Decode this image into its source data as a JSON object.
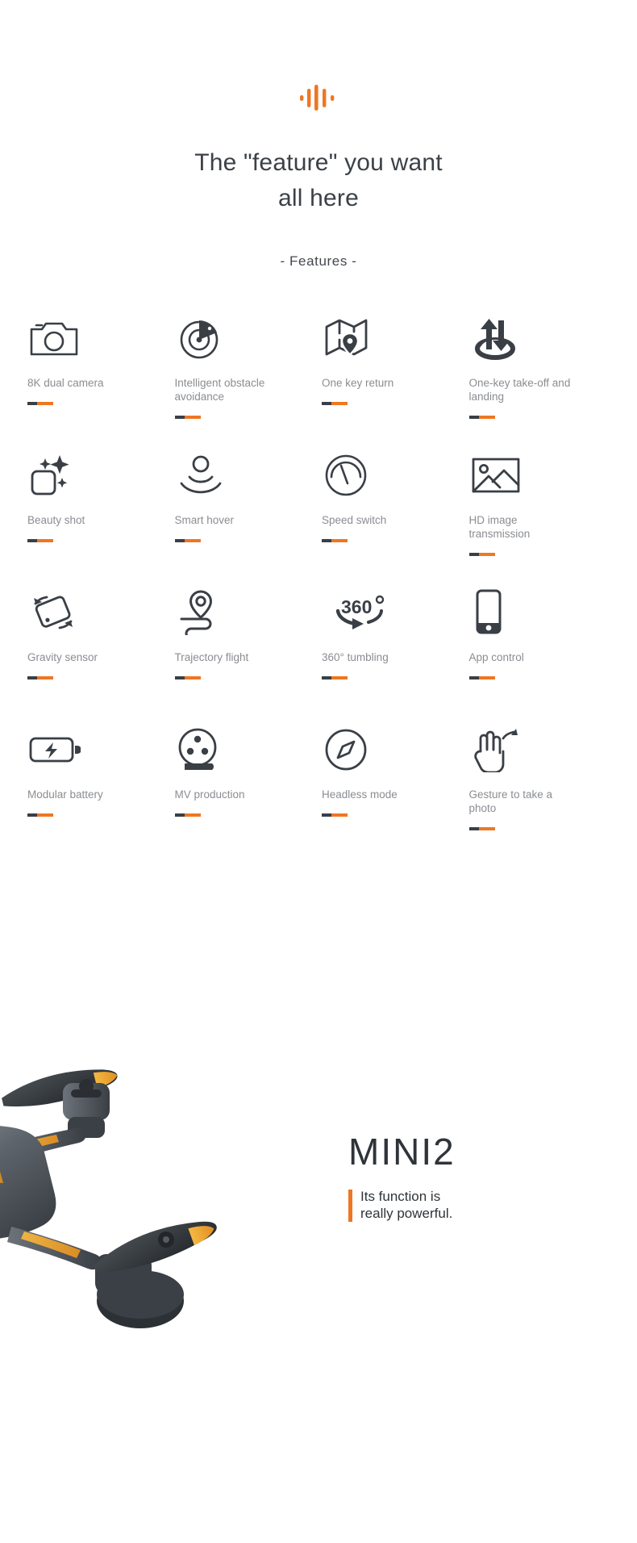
{
  "header": {
    "wave_icon": "audio-wave-icon",
    "wave_color": "#ee7722",
    "headline_line1": "The \"feature\" you want",
    "headline_line2": "all here",
    "section_label": "- Features -"
  },
  "accent": {
    "dark_color": "#3a3f46",
    "orange_color": "#ee7722"
  },
  "features": [
    {
      "icon": "camera-icon",
      "label": "8K dual camera"
    },
    {
      "icon": "radar-obstacle-icon",
      "label": "Intelligent obstacle avoidance"
    },
    {
      "icon": "map-pin-icon",
      "label": "One key return"
    },
    {
      "icon": "takeoff-landing-icon",
      "label": "One-key take-off and landing"
    },
    {
      "icon": "beauty-sparkle-icon",
      "label": "Beauty shot"
    },
    {
      "icon": "hover-signal-icon",
      "label": "Smart hover"
    },
    {
      "icon": "speedometer-icon",
      "label": "Speed switch"
    },
    {
      "icon": "image-picture-icon",
      "label": "HD image transmission"
    },
    {
      "icon": "gravity-sensor-icon",
      "label": "Gravity sensor"
    },
    {
      "icon": "trajectory-path-icon",
      "label": "Trajectory flight"
    },
    {
      "icon": "rotate-360-icon",
      "label": "360° tumbling"
    },
    {
      "icon": "smartphone-icon",
      "label": "App control"
    },
    {
      "icon": "battery-bolt-icon",
      "label": "Modular battery"
    },
    {
      "icon": "film-reel-icon",
      "label": "MV production"
    },
    {
      "icon": "compass-icon",
      "label": "Headless mode"
    },
    {
      "icon": "gesture-hand-icon",
      "label": "Gesture to take a photo"
    }
  ],
  "product": {
    "brand_name": "MINI2",
    "tagline_line1": "Its function is",
    "tagline_line2": "really powerful.",
    "tagline_bar_color": "#ee7722",
    "drone_image": "folding-drone-photo"
  }
}
